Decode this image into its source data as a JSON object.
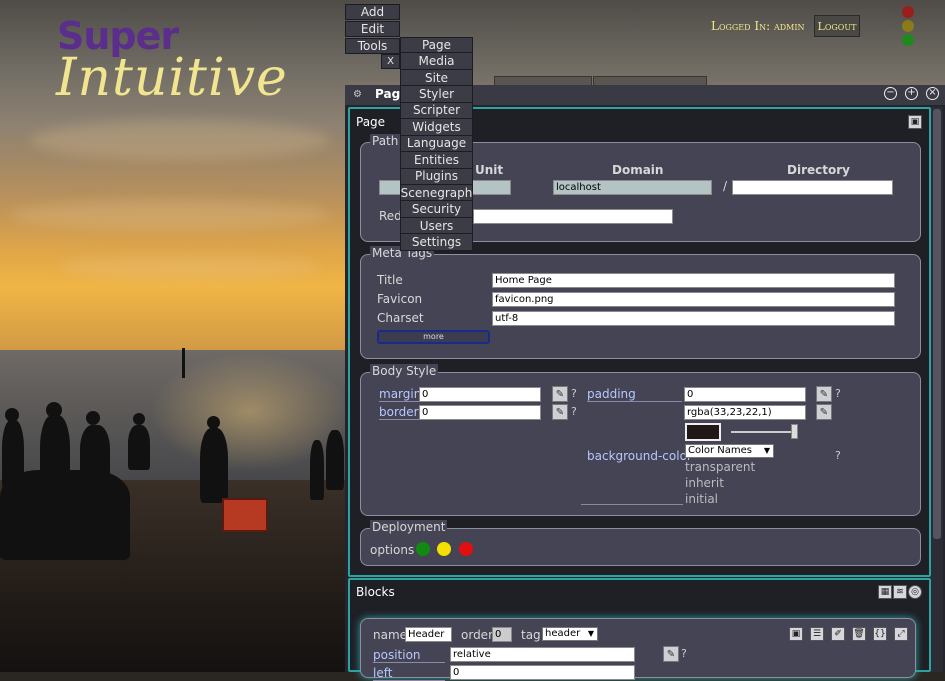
{
  "logo": {
    "line1": "Super",
    "line2": "Intuitive"
  },
  "header": {
    "logged_in": "Logged In: admin",
    "logout": "Logout",
    "status_colors": [
      "#9b1e1e",
      "#8a7a1a",
      "#1e8a1e"
    ]
  },
  "top_menu": {
    "add": "Add",
    "edit": "Edit",
    "tools": "Tools",
    "close": "X",
    "tools_items": [
      "Page",
      "Media",
      "Site",
      "Styler",
      "Scripter",
      "Widgets",
      "Language",
      "Entities",
      "Plugins",
      "Scenegraph",
      "Security",
      "Users",
      "Settings"
    ]
  },
  "panel": {
    "title": "Page",
    "page_label": "Page",
    "path": {
      "legend": "Path",
      "col_unit": "Unit",
      "col_domain": "Domain",
      "col_directory": "Directory",
      "domain_value": "localhost",
      "slash": "/",
      "redirect_label": "Redi"
    },
    "meta": {
      "legend": "Meta Tags",
      "title_label": "Title",
      "title_value": "Home Page",
      "favicon_label": "Favicon",
      "favicon_value": "favicon.png",
      "charset_label": "Charset",
      "charset_value": "utf-8",
      "more_button": "more"
    },
    "body_style": {
      "legend": "Body Style",
      "margin_label": "margin",
      "margin_value": "0",
      "border_label": "border",
      "border_value": "0",
      "padding_label": "padding",
      "padding_value": "0",
      "bg_label": "background-color",
      "bg_value": "rgba(33,23,22,1)",
      "bg_swatch": "#211716",
      "color_select": "Color Names",
      "options": [
        "transparent",
        "inherit",
        "initial"
      ],
      "help": "?"
    },
    "deployment": {
      "legend": "Deployment",
      "options_label": "options",
      "dot_colors": [
        "#118a11",
        "#f2e000",
        "#e01010"
      ]
    },
    "blocks": {
      "title": "Blocks",
      "name_label": "name",
      "name_value": "Header",
      "order_label": "order",
      "order_value": "0",
      "tag_label": "tag",
      "tag_value": "header",
      "position_label": "position",
      "position_value": "relative",
      "left_label": "left",
      "left_value": "0"
    }
  }
}
